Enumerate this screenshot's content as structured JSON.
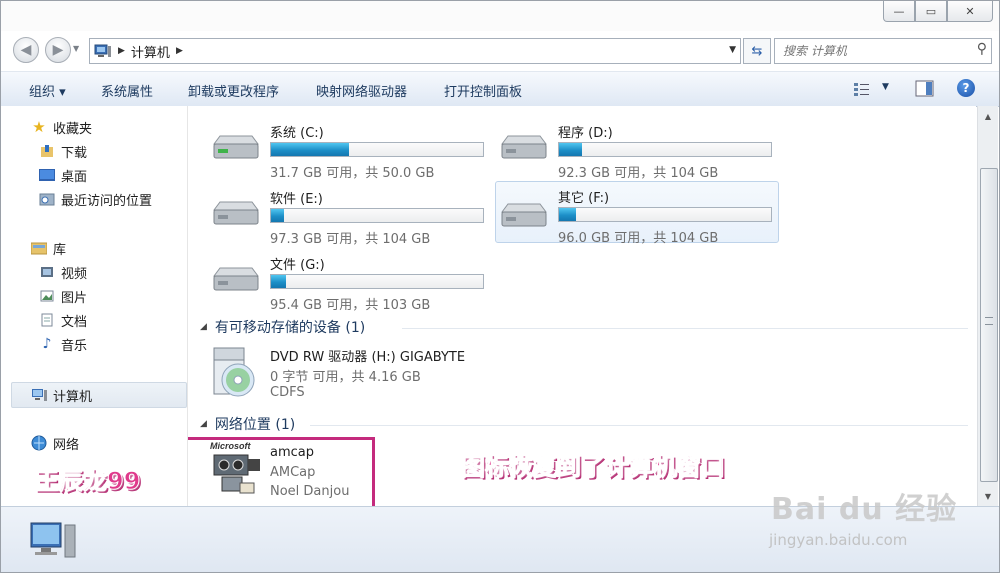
{
  "window": {
    "minimize_glyph": "—",
    "maximize_glyph": "▭",
    "close_glyph": "✕"
  },
  "address": {
    "crumb": "计算机",
    "search_placeholder": "搜索 计算机"
  },
  "toolbar": {
    "organize": "组织 ▾",
    "system_properties": "系统属性",
    "uninstall": "卸载或更改程序",
    "map_drive": "映射网络驱动器",
    "control_panel": "打开控制面板"
  },
  "sidebar": {
    "favorites": "收藏夹",
    "downloads": "下载",
    "desktop": "桌面",
    "recent": "最近访问的位置",
    "libraries": "库",
    "videos": "视频",
    "pictures": "图片",
    "documents": "文档",
    "music": "音乐",
    "computer": "计算机",
    "network": "网络"
  },
  "drives": [
    {
      "name": "系统 (C:)",
      "free": "31.7 GB 可用，共 50.0 GB",
      "used_fraction": 0.37
    },
    {
      "name": "程序 (D:)",
      "free": "92.3 GB 可用，共 104 GB",
      "used_fraction": 0.11
    },
    {
      "name": "软件 (E:)",
      "free": "97.3 GB 可用，共 104 GB",
      "used_fraction": 0.06
    },
    {
      "name": "其它 (F:)",
      "free": "96.0 GB 可用，共 104 GB",
      "used_fraction": 0.08
    },
    {
      "name": "文件 (G:)",
      "free": "95.4 GB 可用，共 103 GB",
      "used_fraction": 0.07
    }
  ],
  "removable": {
    "header": "有可移动存储的设备 (1)",
    "dvd_name": "DVD RW 驱动器 (H:) GIGABYTE",
    "dvd_free": "0 字节 可用，共 4.16 GB",
    "dvd_fs": "CDFS"
  },
  "network_loc": {
    "header": "网络位置 (1)",
    "name": "amcap",
    "desc": "AMCap",
    "author": "Noel Danjou",
    "logo_text": "Microsoft"
  },
  "annotations": {
    "author_watermark": "王辰龙99",
    "note": "图标恢复到了计算机窗口",
    "baidu": "Bai du 经验",
    "baidu_url": "jingyan.baidu.com"
  },
  "colors": {
    "annotation": "#e03a8c",
    "highlight_box": "#c42a7d",
    "drive_fill": "#1d8fc8"
  }
}
